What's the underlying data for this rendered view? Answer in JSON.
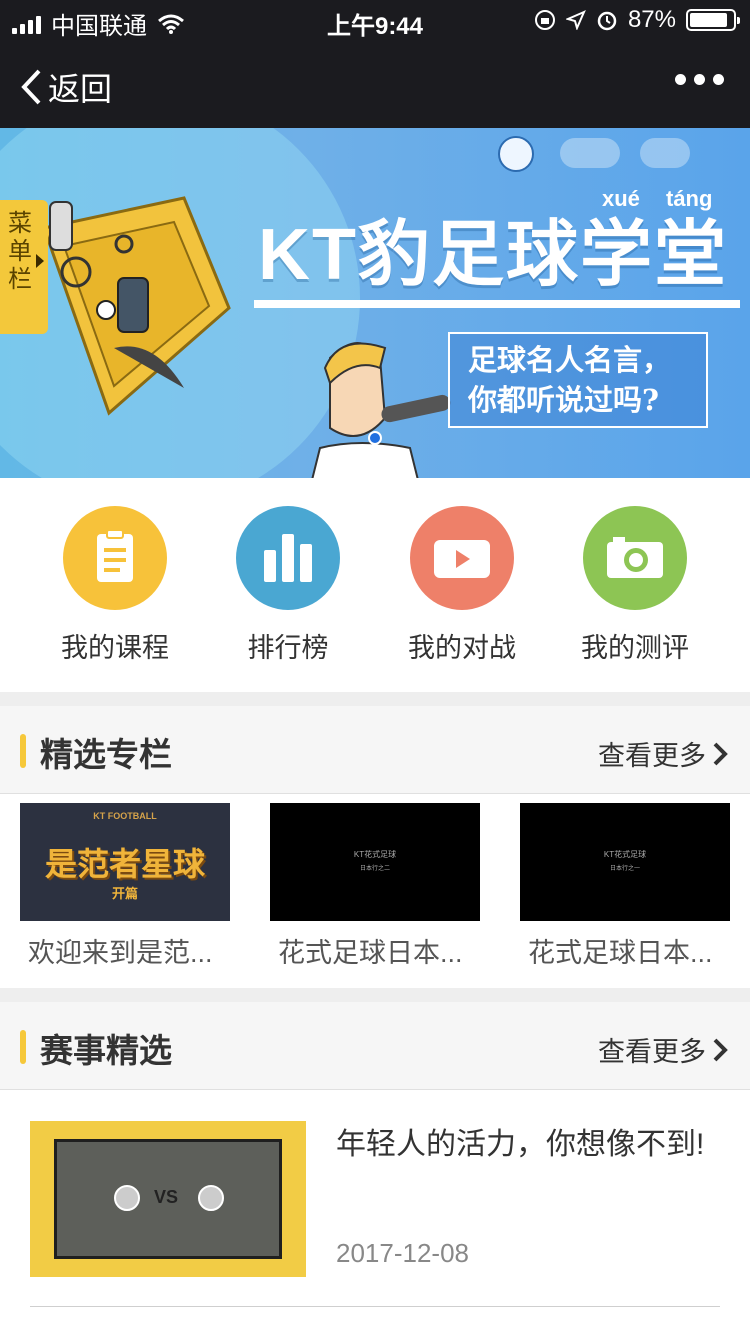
{
  "status_bar": {
    "carrier": "中国联通",
    "time": "上午9:44",
    "battery_percent_text": "87%",
    "battery_level": 0.87
  },
  "nav": {
    "back_label": "返回"
  },
  "banner": {
    "menu_tab": "菜单栏",
    "pinyin_xue": "xué",
    "pinyin_tang": "táng",
    "title": "KT豹足球学堂",
    "quote_line1": "足球名人名言，",
    "quote_line2": "你都听说过吗?"
  },
  "icon_menu": [
    {
      "label": "我的课程",
      "color": "#f7c23a",
      "icon": "clipboard-icon"
    },
    {
      "label": "排行榜",
      "color": "#4aa7d2",
      "icon": "bar-chart-icon"
    },
    {
      "label": "我的对战",
      "color": "#ee8069",
      "icon": "video-play-icon"
    },
    {
      "label": "我的测评",
      "color": "#8dc554",
      "icon": "camera-icon"
    }
  ],
  "featured_columns": {
    "title": "精选专栏",
    "more_label": "查看更多",
    "items": [
      {
        "title": "欢迎来到是范...",
        "thumb_text": "是范者星球",
        "thumb_sub": "开篇",
        "thumb_top": "KT FOOTBALL"
      },
      {
        "title": "花式足球日本...",
        "thumb_text": "KT花式足球",
        "thumb_sub": "日本行之二"
      },
      {
        "title": "花式足球日本...",
        "thumb_text": "KT花式足球",
        "thumb_sub": "日本行之一"
      }
    ]
  },
  "event_selection": {
    "title": "赛事精选",
    "more_label": "查看更多",
    "items": [
      {
        "title": "年轻人的活力，你想像不到!",
        "date": "2017-12-08"
      }
    ]
  },
  "colors": {
    "accent_yellow": "#f6c83a",
    "bar_dark": "#1b1b1f",
    "banner_blue": "#62b8e6"
  }
}
